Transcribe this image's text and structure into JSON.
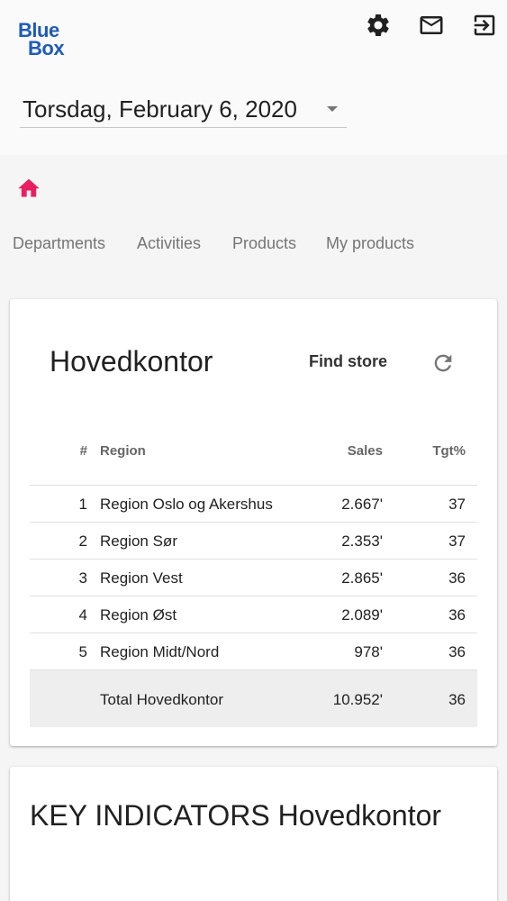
{
  "brand": {
    "logo_line1": "Blue",
    "logo_line2": "Box",
    "color": "#1e5bb8"
  },
  "topbar": {
    "icons": [
      "gear-icon",
      "mail-icon",
      "logout-icon"
    ]
  },
  "date_select": {
    "value": "Torsdag, February 6, 2020"
  },
  "nav": {
    "home_icon_color": "#e91e63",
    "tabs": [
      {
        "label": "Departments"
      },
      {
        "label": "Activities"
      },
      {
        "label": "Products"
      },
      {
        "label": "My products"
      }
    ]
  },
  "store_card": {
    "title": "Hovedkontor",
    "find_store_label": "Find store",
    "table": {
      "headers": {
        "num": "#",
        "region": "Region",
        "sales": "Sales",
        "tgt": "Tgt%"
      },
      "rows": [
        {
          "num": "1",
          "region": "Region Oslo og Akershus",
          "sales": "2.667'",
          "tgt": "37"
        },
        {
          "num": "2",
          "region": "Region Sør",
          "sales": "2.353'",
          "tgt": "37"
        },
        {
          "num": "3",
          "region": "Region Vest",
          "sales": "2.865'",
          "tgt": "36"
        },
        {
          "num": "4",
          "region": "Region Øst",
          "sales": "2.089'",
          "tgt": "36"
        },
        {
          "num": "5",
          "region": "Region Midt/Nord",
          "sales": "978'",
          "tgt": "36"
        }
      ],
      "total": {
        "label": "Total Hovedkontor",
        "sales": "10.952'",
        "tgt": "36"
      }
    }
  },
  "indicators_card": {
    "title": "KEY INDICATORS Hovedkontor"
  }
}
